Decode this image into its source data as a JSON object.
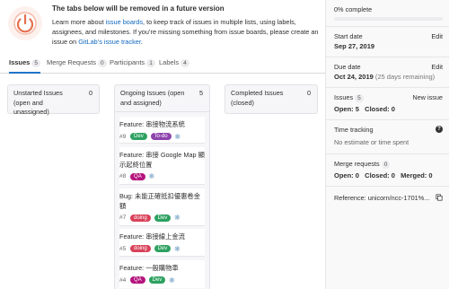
{
  "notice": {
    "title": "The tabs below will be removed in a future version",
    "line1_a": "Learn more about ",
    "line1_link": "issue boards",
    "line1_b": ", to keep track of issues in multiple lists, using labels,",
    "line2": "assignees, and milestones. If you’re missing something from issue boards, please create an",
    "line3_a": "issue on ",
    "line3_link": "GitLab’s issue tracker",
    "line3_b": "."
  },
  "tabs": [
    {
      "label": "Issues",
      "count": "5"
    },
    {
      "label": "Merge Requests",
      "count": "0"
    },
    {
      "label": "Participants",
      "count": "1"
    },
    {
      "label": "Labels",
      "count": "4"
    }
  ],
  "columns": {
    "unstarted": {
      "title": "Unstarted Issues (open and unassigned)",
      "count": "0"
    },
    "ongoing": {
      "title": "Ongoing Issues (open and assigned)",
      "count": "5"
    },
    "completed": {
      "title": "Completed Issues (closed)",
      "count": "0"
    }
  },
  "labels": {
    "Dev": "#2da160",
    "To-do": "#8e44ad",
    "QA": "#b5147d",
    "doing": "#d9425a"
  },
  "cards": [
    {
      "title": "Feature: 串接物流系統",
      "number": "#9",
      "labels": [
        "Dev",
        "To-do"
      ]
    },
    {
      "title": "Feature: 串接 Google Map 顯示起終位置",
      "number": "#8",
      "labels": [
        "QA"
      ]
    },
    {
      "title": "Bug: 未能正確抵扣優惠卷金額",
      "number": "#7",
      "labels": [
        "doing",
        "Dev"
      ]
    },
    {
      "title": "Feature: 串接線上金流",
      "number": "#5",
      "labels": [
        "doing",
        "Dev"
      ]
    },
    {
      "title": "Feature: 一般購物車",
      "number": "#4",
      "labels": [
        "QA",
        "Dev"
      ]
    }
  ],
  "sidebar": {
    "progress_label": "0% complete",
    "progress_fraction": 0,
    "start_label": "Start date",
    "start_value": "Sep 27, 2019",
    "due_label": "Due date",
    "due_value": "Oct 24, 2019",
    "due_remaining": "(25 days remaining)",
    "edit": "Edit",
    "issues_label": "Issues",
    "issues_count": "5",
    "new_issue": "New issue",
    "issues_summary": "Open: 5   Closed: 0",
    "time_label": "Time tracking",
    "time_value": "No estimate or time spent",
    "mr_label": "Merge requests",
    "mr_count": "0",
    "mr_summary": "Open: 0   Closed: 0   Merged: 0",
    "reference": "Reference: unicorn/ncc-1701%..."
  }
}
